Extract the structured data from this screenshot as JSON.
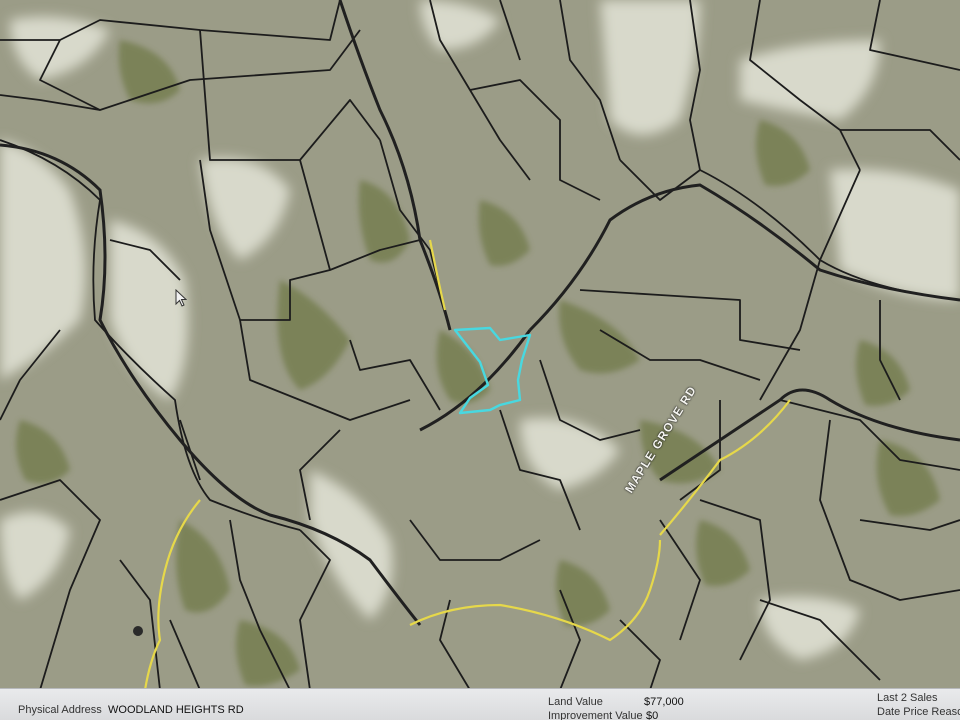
{
  "map": {
    "road_label": "MAPLE GROVE RD",
    "colors": {
      "terrain": "#9a9a86",
      "field": "#d6d6c8",
      "forest": "#7a8252",
      "parcel_line": "#1c1c1c",
      "road": "#e6d84a",
      "selected_parcel": "#48d8e0"
    },
    "icons": [
      "mouse-pointer-icon"
    ]
  },
  "info_bar": {
    "address_label": "Physical Address",
    "address_value": "WOODLAND HEIGHTS RD",
    "land_value_label": "Land Value",
    "land_value": "$77,000",
    "improvement_value_label": "Improvement Value",
    "improvement_value": "$0",
    "last_sales_label": "Last 2 Sales",
    "sales_columns": "Date  Price  Reaso"
  }
}
